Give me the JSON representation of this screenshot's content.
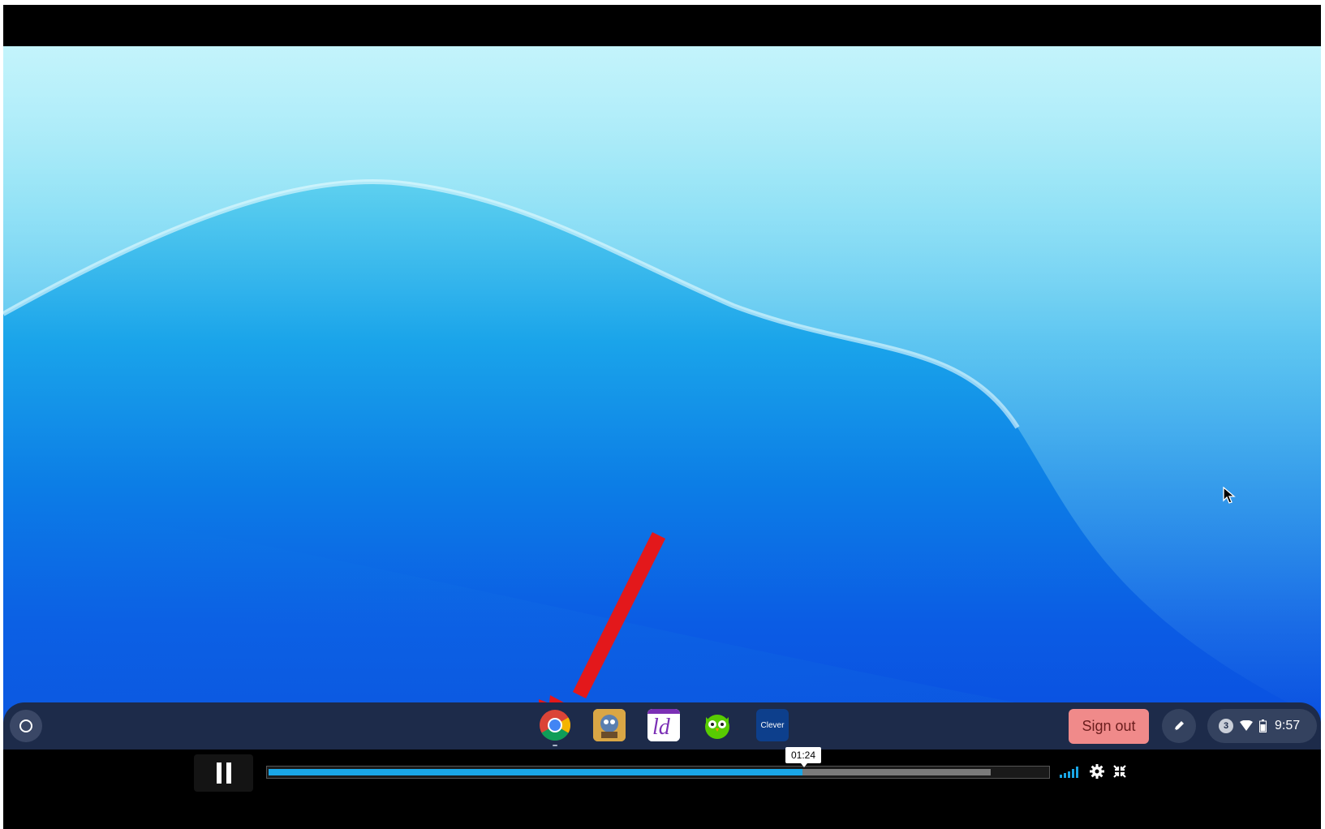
{
  "shelf": {
    "launcher_icon": "launcher-circle-icon",
    "apps": [
      {
        "name": "Google Chrome",
        "icon": "chrome-icon"
      },
      {
        "name": "game-app",
        "icon": "game-character-icon"
      },
      {
        "name": "purple-app",
        "icon": "letters-icon"
      },
      {
        "name": "owl-app",
        "icon": "green-owl-icon"
      },
      {
        "name": "Clever",
        "label": "Clever"
      }
    ],
    "sign_out_label": "Sign out",
    "notification_count": "3",
    "clock": "9:57"
  },
  "player": {
    "current_time": "01:24",
    "progress": 0.685,
    "buffered": 0.927
  },
  "annotation": {
    "arrow_color": "#e3181b"
  },
  "colors": {
    "shelf_bg": "#1d2b4a",
    "sign_out_bg": "#f08a8a",
    "progress_fill": "#1aa6e6"
  }
}
